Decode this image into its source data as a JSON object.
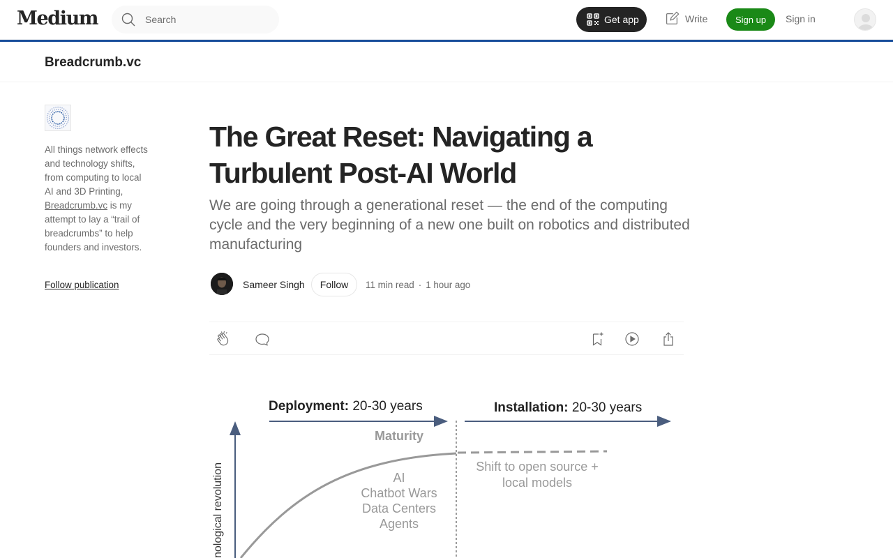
{
  "header": {
    "logo": "Medium",
    "search_placeholder": "Search",
    "get_app": "Get app",
    "write": "Write",
    "sign_up": "Sign up",
    "sign_in": "Sign in"
  },
  "publication": {
    "name": "Breadcrumb.vc",
    "description_before": "All things network effects and technology shifts, from computing to local AI and 3D Printing, ",
    "description_link": "Breadcrumb.vc",
    "description_after": " is my attempt to lay a “trail of breadcrumbs” to help founders and investors.",
    "follow_label": "Follow publication"
  },
  "article": {
    "title": "The Great Reset: Navigating a Turbulent Post-AI World",
    "subtitle": "We are going through a generational reset — the end of the computing cycle and the very beginning of a new one built on robotics and distributed manufacturing",
    "author": "Sameer Singh",
    "follow": "Follow",
    "read_time": "11 min read",
    "separator": "·",
    "published": "1 hour ago"
  },
  "actions": {
    "icons": [
      "clap-icon",
      "comment-icon",
      "bookmark-icon",
      "listen-icon",
      "share-icon"
    ]
  },
  "figure": {
    "deployment_bold": "Deployment:",
    "deployment_rest": " 20-30 years",
    "installation_bold": "Installation:",
    "installation_rest": " 20-30 years",
    "maturity": "Maturity",
    "shift_line1": "Shift to open source +",
    "shift_line2": "local models",
    "phase_items": [
      "AI",
      "Chatbot Wars",
      "Data Centers",
      "Agents"
    ],
    "y_axis_label": "nological revolution"
  },
  "colors": {
    "brand_green": "#1a8917",
    "accent_blue": "#1a4f9c",
    "text_primary": "#242424",
    "text_secondary": "#6b6b6b",
    "chart_arrow": "#4a5d7e",
    "chart_curve": "#999999"
  }
}
